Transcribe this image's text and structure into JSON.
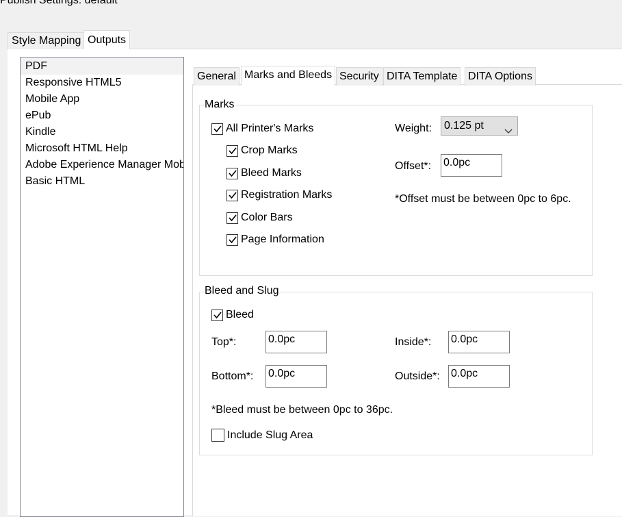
{
  "window": {
    "title": "Publish Settings: default"
  },
  "top_tabs": [
    "Style Mapping",
    "Outputs"
  ],
  "outputs": [
    "PDF",
    "Responsive HTML5",
    "Mobile App",
    "ePub",
    "Kindle",
    "Microsoft HTML Help",
    "Adobe Experience Manager Mobile",
    "Basic HTML"
  ],
  "inner_tabs": [
    "General",
    "Marks and Bleeds",
    "Security",
    "DITA Template",
    "DITA Options"
  ],
  "marks": {
    "legend": "Marks",
    "all_printers_marks": "All Printer's Marks",
    "crop_marks": "Crop Marks",
    "bleed_marks": "Bleed Marks",
    "registration_marks": "Registration Marks",
    "color_bars": "Color Bars",
    "page_information": "Page Information",
    "weight_label": "Weight:",
    "weight_value": "0.125 pt",
    "offset_label": "Offset*:",
    "offset_value": "0.0pc",
    "offset_note": "*Offset must be between 0pc to 6pc."
  },
  "bleed": {
    "legend": "Bleed and Slug",
    "bleed_label": "Bleed",
    "top_label": "Top*:",
    "top_value": "0.0pc",
    "bottom_label": "Bottom*:",
    "bottom_value": "0.0pc",
    "inside_label": "Inside*:",
    "inside_value": "0.0pc",
    "outside_label": "Outside*:",
    "outside_value": "0.0pc",
    "note": "*Bleed must be between 0pc to 36pc.",
    "include_slug_label": "Include Slug Area"
  }
}
